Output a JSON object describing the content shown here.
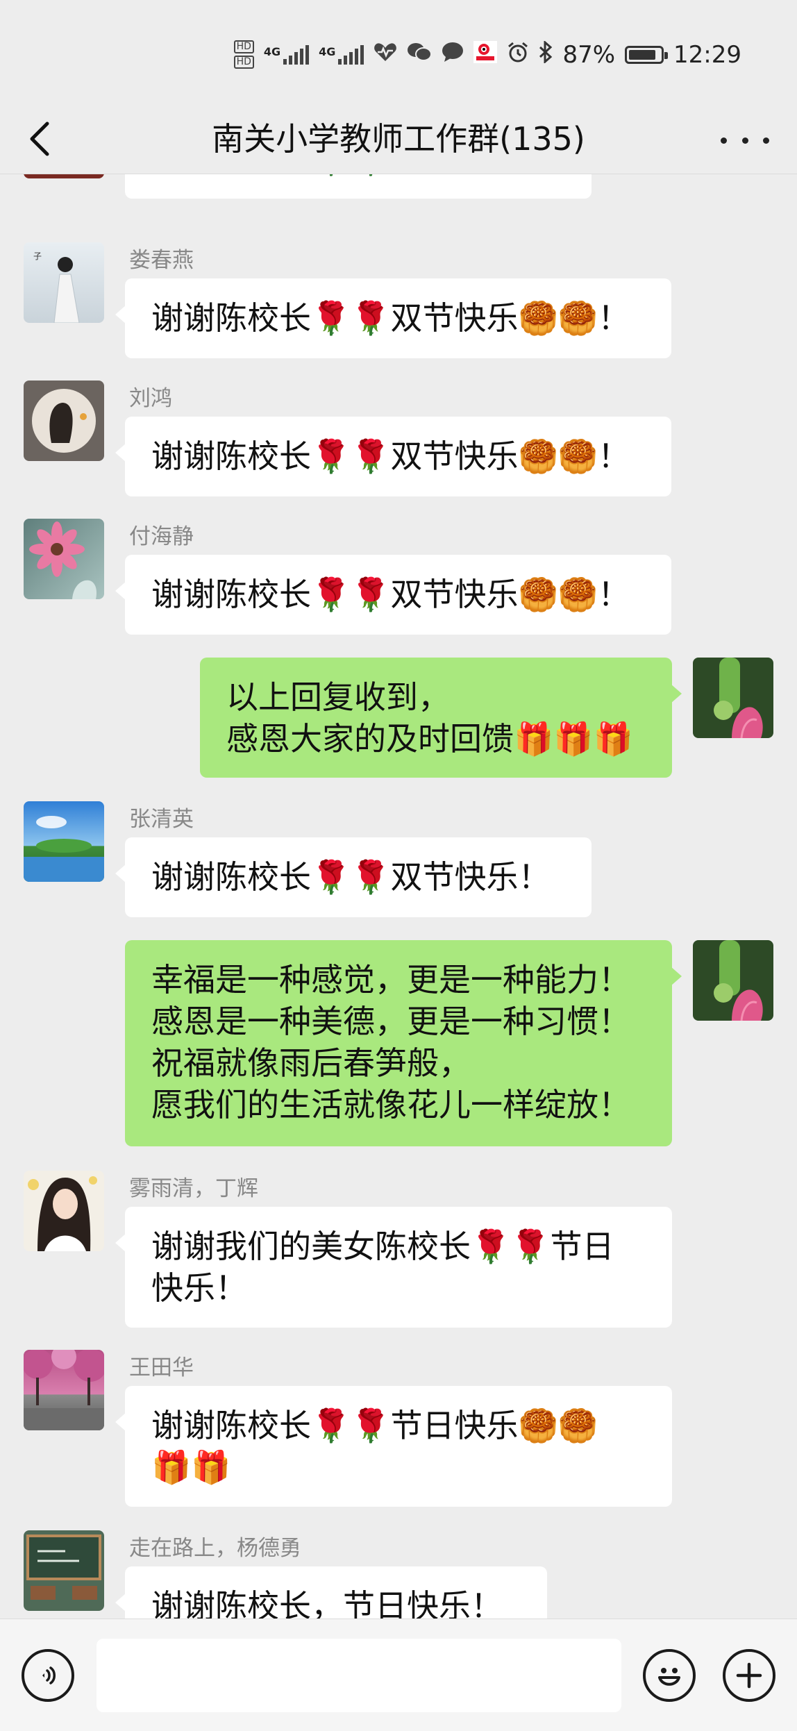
{
  "status_bar": {
    "network_1": "4G",
    "network_2": "4G",
    "hd_label": "HD",
    "battery_text": "87%",
    "battery_level": 0.87,
    "time": "12:29",
    "icons": [
      "hd-icon",
      "signal-icon",
      "signal-icon",
      "heart-health-icon",
      "wechat-icon",
      "message-icon",
      "sina-weibo-icon",
      "alarm-icon",
      "bluetooth-icon",
      "battery-icon"
    ]
  },
  "nav": {
    "title": "南关小学教师工作群(135)",
    "back_icon": "chevron-left-icon",
    "more_icon": "more-dots-icon"
  },
  "messages": [
    {
      "side": "left",
      "sender": "",
      "text": "谢谢陈校长🌹🌹双节快乐！",
      "avatar": "avatar-partial",
      "partial": true
    },
    {
      "side": "left",
      "sender": "娄春燕",
      "text": "谢谢陈校长🌹🌹双节快乐🥮🥮！",
      "avatar": "avatar-hanfu-girl"
    },
    {
      "side": "left",
      "sender": "刘鸿",
      "text": "谢谢陈校长🌹🌹双节快乐🥮🥮！",
      "avatar": "avatar-girl-circle"
    },
    {
      "side": "left",
      "sender": "付海静",
      "text": "谢谢陈校长🌹🌹双节快乐🥮🥮！",
      "avatar": "avatar-pink-flower"
    },
    {
      "side": "right",
      "sender": "",
      "text": "以上回复收到，\n感恩大家的及时回馈🎁🎁🎁",
      "avatar": "avatar-lotus"
    },
    {
      "side": "left",
      "sender": "张清英",
      "text": "谢谢陈校长🌹🌹双节快乐！",
      "avatar": "avatar-landscape"
    },
    {
      "side": "right",
      "sender": "",
      "text": "幸福是一种感觉，更是一种能力！\n感恩是一种美德，更是一种习惯！\n祝福就像雨后春笋般，\n愿我们的生活就像花儿一样绽放！",
      "avatar": "avatar-lotus"
    },
    {
      "side": "left",
      "sender": "雾雨清，丁辉",
      "text": "谢谢我们的美女陈校长🌹🌹节日\n快乐！",
      "avatar": "avatar-woman-portrait"
    },
    {
      "side": "left",
      "sender": "王田华",
      "text": "谢谢陈校长🌹🌹节日快乐🥮🥮\n🎁🎁",
      "avatar": "avatar-cherry-trees"
    },
    {
      "side": "left",
      "sender": "走在路上，杨德勇",
      "text": "谢谢陈校长，节日快乐！",
      "avatar": "avatar-chalkboard"
    }
  ],
  "input_bar": {
    "voice_icon": "voice-icon",
    "emoji_icon": "emoji-icon",
    "plus_icon": "plus-icon",
    "value": ""
  },
  "colors": {
    "background": "#ededed",
    "bubble_white": "#ffffff",
    "bubble_green": "#a9e87e",
    "sender_text": "#888888"
  }
}
